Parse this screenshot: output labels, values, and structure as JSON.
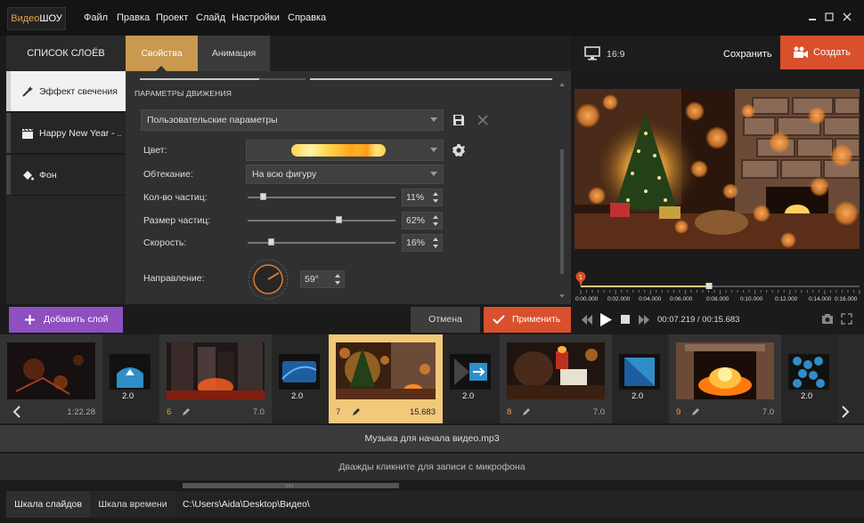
{
  "app": {
    "logo_a": "Видео",
    "logo_b": "ШОУ"
  },
  "menu": {
    "items": [
      "Файл",
      "Правка",
      "Проект",
      "Слайд",
      "Настройки",
      "Справка"
    ]
  },
  "layers": {
    "header": "СПИСОК СЛОЁВ",
    "items": [
      {
        "label": "Эффект свечения",
        "icon": "magic-wand-icon"
      },
      {
        "label": "Happy New Year - ...",
        "icon": "clapperboard-icon"
      },
      {
        "label": "Фон",
        "icon": "paint-bucket-icon"
      }
    ],
    "add_label": "Добавить слой"
  },
  "tabs": {
    "properties": "Свойства",
    "animation": "Анимация"
  },
  "props": {
    "section_title": "ПАРАМЕТРЫ ДВИЖЕНИЯ",
    "preset": "Пользовательские параметры",
    "color_label": "Цвет:",
    "wrap_label": "Обтекание:",
    "wrap_value": "На всю фигуру",
    "count_label": "Кол-во частиц:",
    "count_value": "11%",
    "count_level": 0.11,
    "size_label": "Размер частиц:",
    "size_value": "62%",
    "size_level": 0.62,
    "speed_label": "Скорость:",
    "speed_value": "16%",
    "speed_level": 0.16,
    "direction_label": "Направление:",
    "direction_value": "59°",
    "direction_degrees": 59
  },
  "actions": {
    "cancel": "Отмена",
    "apply": "Применить"
  },
  "preview": {
    "aspect": "16:9",
    "save": "Сохранить",
    "create": "Создать",
    "ruler_ticks": [
      "0:00.000",
      "0:02.000",
      "0:04.000",
      "0:06.000",
      "0:08.000",
      "0:10.000",
      "0:12.000",
      "0:14.000",
      "0:16.000"
    ],
    "marker": "1",
    "time": "00:07.219 / 00:15.683",
    "playhead_fraction": 0.46
  },
  "slides": [
    {
      "num": "",
      "duration": "1:22.28"
    },
    {
      "num": "6",
      "duration": "7.0"
    },
    {
      "num": "7",
      "duration": "15.683"
    },
    {
      "num": "8",
      "duration": "7.0"
    },
    {
      "num": "9",
      "duration": "7.0"
    }
  ],
  "transitions": [
    "2.0",
    "2.0",
    "2.0",
    "2.0",
    "2.0"
  ],
  "tracks": {
    "music": "Музыка для начала видео.mp3",
    "mic": "Дважды кликните для записи с микрофона"
  },
  "bottom": {
    "tab_slides": "Шкала слайдов",
    "tab_timeline": "Шкала времени",
    "path": "C:\\Users\\Aida\\Desktop\\Видео\\"
  },
  "colors": {
    "accent_orange": "#d9502d",
    "accent_gold": "#c8994f",
    "accent_purple": "#8e4fc0"
  }
}
